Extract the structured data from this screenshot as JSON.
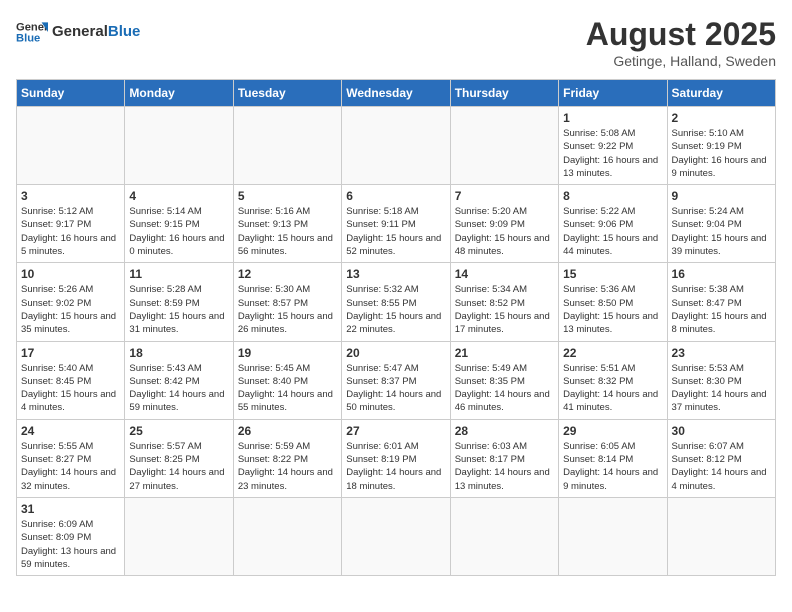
{
  "header": {
    "logo_general": "General",
    "logo_blue": "Blue",
    "month_year": "August 2025",
    "location": "Getinge, Halland, Sweden"
  },
  "days_of_week": [
    "Sunday",
    "Monday",
    "Tuesday",
    "Wednesday",
    "Thursday",
    "Friday",
    "Saturday"
  ],
  "weeks": [
    [
      {
        "day": "",
        "info": ""
      },
      {
        "day": "",
        "info": ""
      },
      {
        "day": "",
        "info": ""
      },
      {
        "day": "",
        "info": ""
      },
      {
        "day": "",
        "info": ""
      },
      {
        "day": "1",
        "info": "Sunrise: 5:08 AM\nSunset: 9:22 PM\nDaylight: 16 hours and 13 minutes."
      },
      {
        "day": "2",
        "info": "Sunrise: 5:10 AM\nSunset: 9:19 PM\nDaylight: 16 hours and 9 minutes."
      }
    ],
    [
      {
        "day": "3",
        "info": "Sunrise: 5:12 AM\nSunset: 9:17 PM\nDaylight: 16 hours and 5 minutes."
      },
      {
        "day": "4",
        "info": "Sunrise: 5:14 AM\nSunset: 9:15 PM\nDaylight: 16 hours and 0 minutes."
      },
      {
        "day": "5",
        "info": "Sunrise: 5:16 AM\nSunset: 9:13 PM\nDaylight: 15 hours and 56 minutes."
      },
      {
        "day": "6",
        "info": "Sunrise: 5:18 AM\nSunset: 9:11 PM\nDaylight: 15 hours and 52 minutes."
      },
      {
        "day": "7",
        "info": "Sunrise: 5:20 AM\nSunset: 9:09 PM\nDaylight: 15 hours and 48 minutes."
      },
      {
        "day": "8",
        "info": "Sunrise: 5:22 AM\nSunset: 9:06 PM\nDaylight: 15 hours and 44 minutes."
      },
      {
        "day": "9",
        "info": "Sunrise: 5:24 AM\nSunset: 9:04 PM\nDaylight: 15 hours and 39 minutes."
      }
    ],
    [
      {
        "day": "10",
        "info": "Sunrise: 5:26 AM\nSunset: 9:02 PM\nDaylight: 15 hours and 35 minutes."
      },
      {
        "day": "11",
        "info": "Sunrise: 5:28 AM\nSunset: 8:59 PM\nDaylight: 15 hours and 31 minutes."
      },
      {
        "day": "12",
        "info": "Sunrise: 5:30 AM\nSunset: 8:57 PM\nDaylight: 15 hours and 26 minutes."
      },
      {
        "day": "13",
        "info": "Sunrise: 5:32 AM\nSunset: 8:55 PM\nDaylight: 15 hours and 22 minutes."
      },
      {
        "day": "14",
        "info": "Sunrise: 5:34 AM\nSunset: 8:52 PM\nDaylight: 15 hours and 17 minutes."
      },
      {
        "day": "15",
        "info": "Sunrise: 5:36 AM\nSunset: 8:50 PM\nDaylight: 15 hours and 13 minutes."
      },
      {
        "day": "16",
        "info": "Sunrise: 5:38 AM\nSunset: 8:47 PM\nDaylight: 15 hours and 8 minutes."
      }
    ],
    [
      {
        "day": "17",
        "info": "Sunrise: 5:40 AM\nSunset: 8:45 PM\nDaylight: 15 hours and 4 minutes."
      },
      {
        "day": "18",
        "info": "Sunrise: 5:43 AM\nSunset: 8:42 PM\nDaylight: 14 hours and 59 minutes."
      },
      {
        "day": "19",
        "info": "Sunrise: 5:45 AM\nSunset: 8:40 PM\nDaylight: 14 hours and 55 minutes."
      },
      {
        "day": "20",
        "info": "Sunrise: 5:47 AM\nSunset: 8:37 PM\nDaylight: 14 hours and 50 minutes."
      },
      {
        "day": "21",
        "info": "Sunrise: 5:49 AM\nSunset: 8:35 PM\nDaylight: 14 hours and 46 minutes."
      },
      {
        "day": "22",
        "info": "Sunrise: 5:51 AM\nSunset: 8:32 PM\nDaylight: 14 hours and 41 minutes."
      },
      {
        "day": "23",
        "info": "Sunrise: 5:53 AM\nSunset: 8:30 PM\nDaylight: 14 hours and 37 minutes."
      }
    ],
    [
      {
        "day": "24",
        "info": "Sunrise: 5:55 AM\nSunset: 8:27 PM\nDaylight: 14 hours and 32 minutes."
      },
      {
        "day": "25",
        "info": "Sunrise: 5:57 AM\nSunset: 8:25 PM\nDaylight: 14 hours and 27 minutes."
      },
      {
        "day": "26",
        "info": "Sunrise: 5:59 AM\nSunset: 8:22 PM\nDaylight: 14 hours and 23 minutes."
      },
      {
        "day": "27",
        "info": "Sunrise: 6:01 AM\nSunset: 8:19 PM\nDaylight: 14 hours and 18 minutes."
      },
      {
        "day": "28",
        "info": "Sunrise: 6:03 AM\nSunset: 8:17 PM\nDaylight: 14 hours and 13 minutes."
      },
      {
        "day": "29",
        "info": "Sunrise: 6:05 AM\nSunset: 8:14 PM\nDaylight: 14 hours and 9 minutes."
      },
      {
        "day": "30",
        "info": "Sunrise: 6:07 AM\nSunset: 8:12 PM\nDaylight: 14 hours and 4 minutes."
      }
    ],
    [
      {
        "day": "31",
        "info": "Sunrise: 6:09 AM\nSunset: 8:09 PM\nDaylight: 13 hours and 59 minutes."
      },
      {
        "day": "",
        "info": ""
      },
      {
        "day": "",
        "info": ""
      },
      {
        "day": "",
        "info": ""
      },
      {
        "day": "",
        "info": ""
      },
      {
        "day": "",
        "info": ""
      },
      {
        "day": "",
        "info": ""
      }
    ]
  ]
}
